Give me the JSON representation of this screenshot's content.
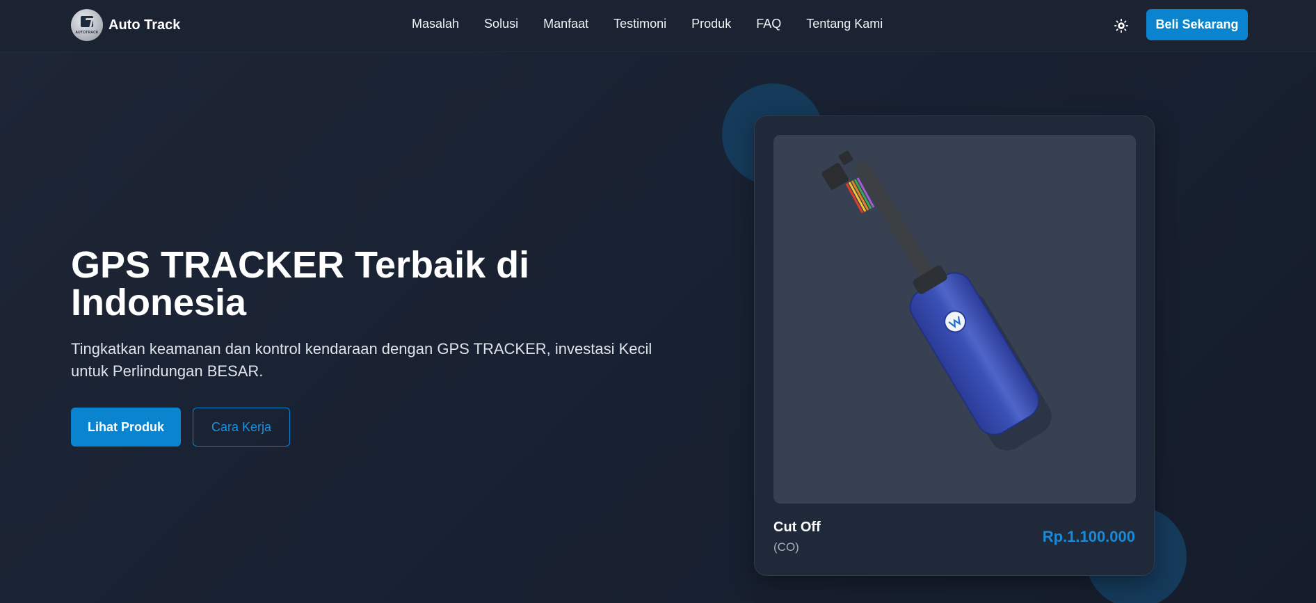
{
  "brand": {
    "name": "Auto Track",
    "logo_text": "AUTOTRACK"
  },
  "nav": {
    "links": [
      "Masalah",
      "Solusi",
      "Manfaat",
      "Testimoni",
      "Produk",
      "FAQ",
      "Tentang Kami"
    ],
    "theme_icon": "gear-sun-icon",
    "cta": "Beli Sekarang"
  },
  "hero": {
    "title": "GPS TRACKER Terbaik di Indonesia",
    "subtitle": "Tingkatkan keamanan dan kontrol kendaraan dengan GPS TRACKER, investasi Kecil untuk Perlindungan BESAR.",
    "primary_button": "Lihat Produk",
    "secondary_button": "Cara Kerja"
  },
  "product": {
    "name": "Cut Off",
    "code": "(CO)",
    "price": "Rp.1.100.000",
    "image_icon": "gps-tracker-device-icon"
  },
  "colors": {
    "accent": "#0b84cf",
    "background": "#1a2232",
    "card": "#1f293a",
    "price": "#1a8ad6"
  }
}
